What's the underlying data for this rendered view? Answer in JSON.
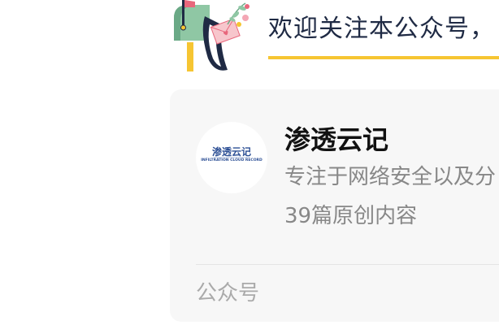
{
  "header": {
    "welcome_text": "欢迎关注本公众号，"
  },
  "account_card": {
    "avatar": {
      "logo_text": "渗透云记",
      "logo_subtext": "INFILTRATION CLOUD RECORD"
    },
    "name": "渗透云记",
    "description": "专注于网络安全以及分",
    "original_count": "39篇原创内容",
    "footer_label": "公众号"
  },
  "colors": {
    "welcome_text": "#1f2a44",
    "underline": "#f6c532",
    "card_background": "#f7f7f7",
    "secondary_text": "#888888",
    "footer_text": "#aaaaaa",
    "logo_blue": "#2c4f95"
  },
  "icons": {
    "banner_illustration": "mailbox-icon"
  }
}
